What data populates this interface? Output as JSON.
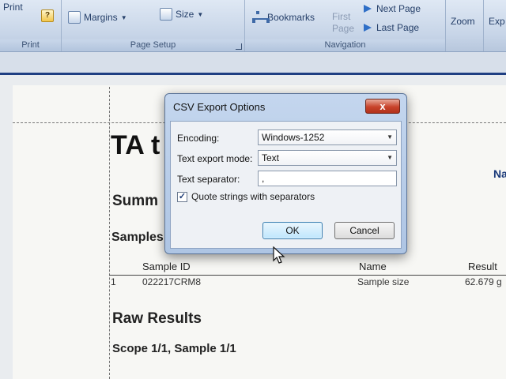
{
  "ribbon": {
    "print_button": "Print",
    "print_group": "Print",
    "margins_label": "Margins",
    "size_label": "Size",
    "page_setup_group": "Page Setup",
    "bookmarks_label": "Bookmarks",
    "first_page_label": "First Page",
    "next_page_label": "Next Page",
    "last_page_label": "Last Page",
    "navigation_group": "Navigation",
    "zoom_label": "Zoom",
    "exp_label": "Exp"
  },
  "document": {
    "title": "TA t",
    "summary_heading": "Summ",
    "samples_heading": "Samples",
    "logo_text": "Na",
    "table": {
      "headers": [
        "Sample ID",
        "Name",
        "Result"
      ],
      "rows": [
        [
          "1",
          "022217CRM8",
          "Sample size",
          "62.679 g"
        ]
      ]
    },
    "raw_results_heading": "Raw Results",
    "scope_heading": "Scope 1/1, Sample 1/1"
  },
  "dialog": {
    "title": "CSV Export Options",
    "close_glyph": "x",
    "encoding_label": "Encoding:",
    "encoding_value": "Windows-1252",
    "mode_label": "Text export mode:",
    "mode_value": "Text",
    "separator_label": "Text separator:",
    "separator_value": ",",
    "quote_label": "Quote strings with separators",
    "quote_checked": true,
    "ok_label": "OK",
    "cancel_label": "Cancel"
  },
  "colors": {
    "ribbon_bg": "#c6d4e7",
    "close_red": "#c8432b",
    "ok_blue": "#bee6fd",
    "frame_blue": "#1f3f82"
  }
}
